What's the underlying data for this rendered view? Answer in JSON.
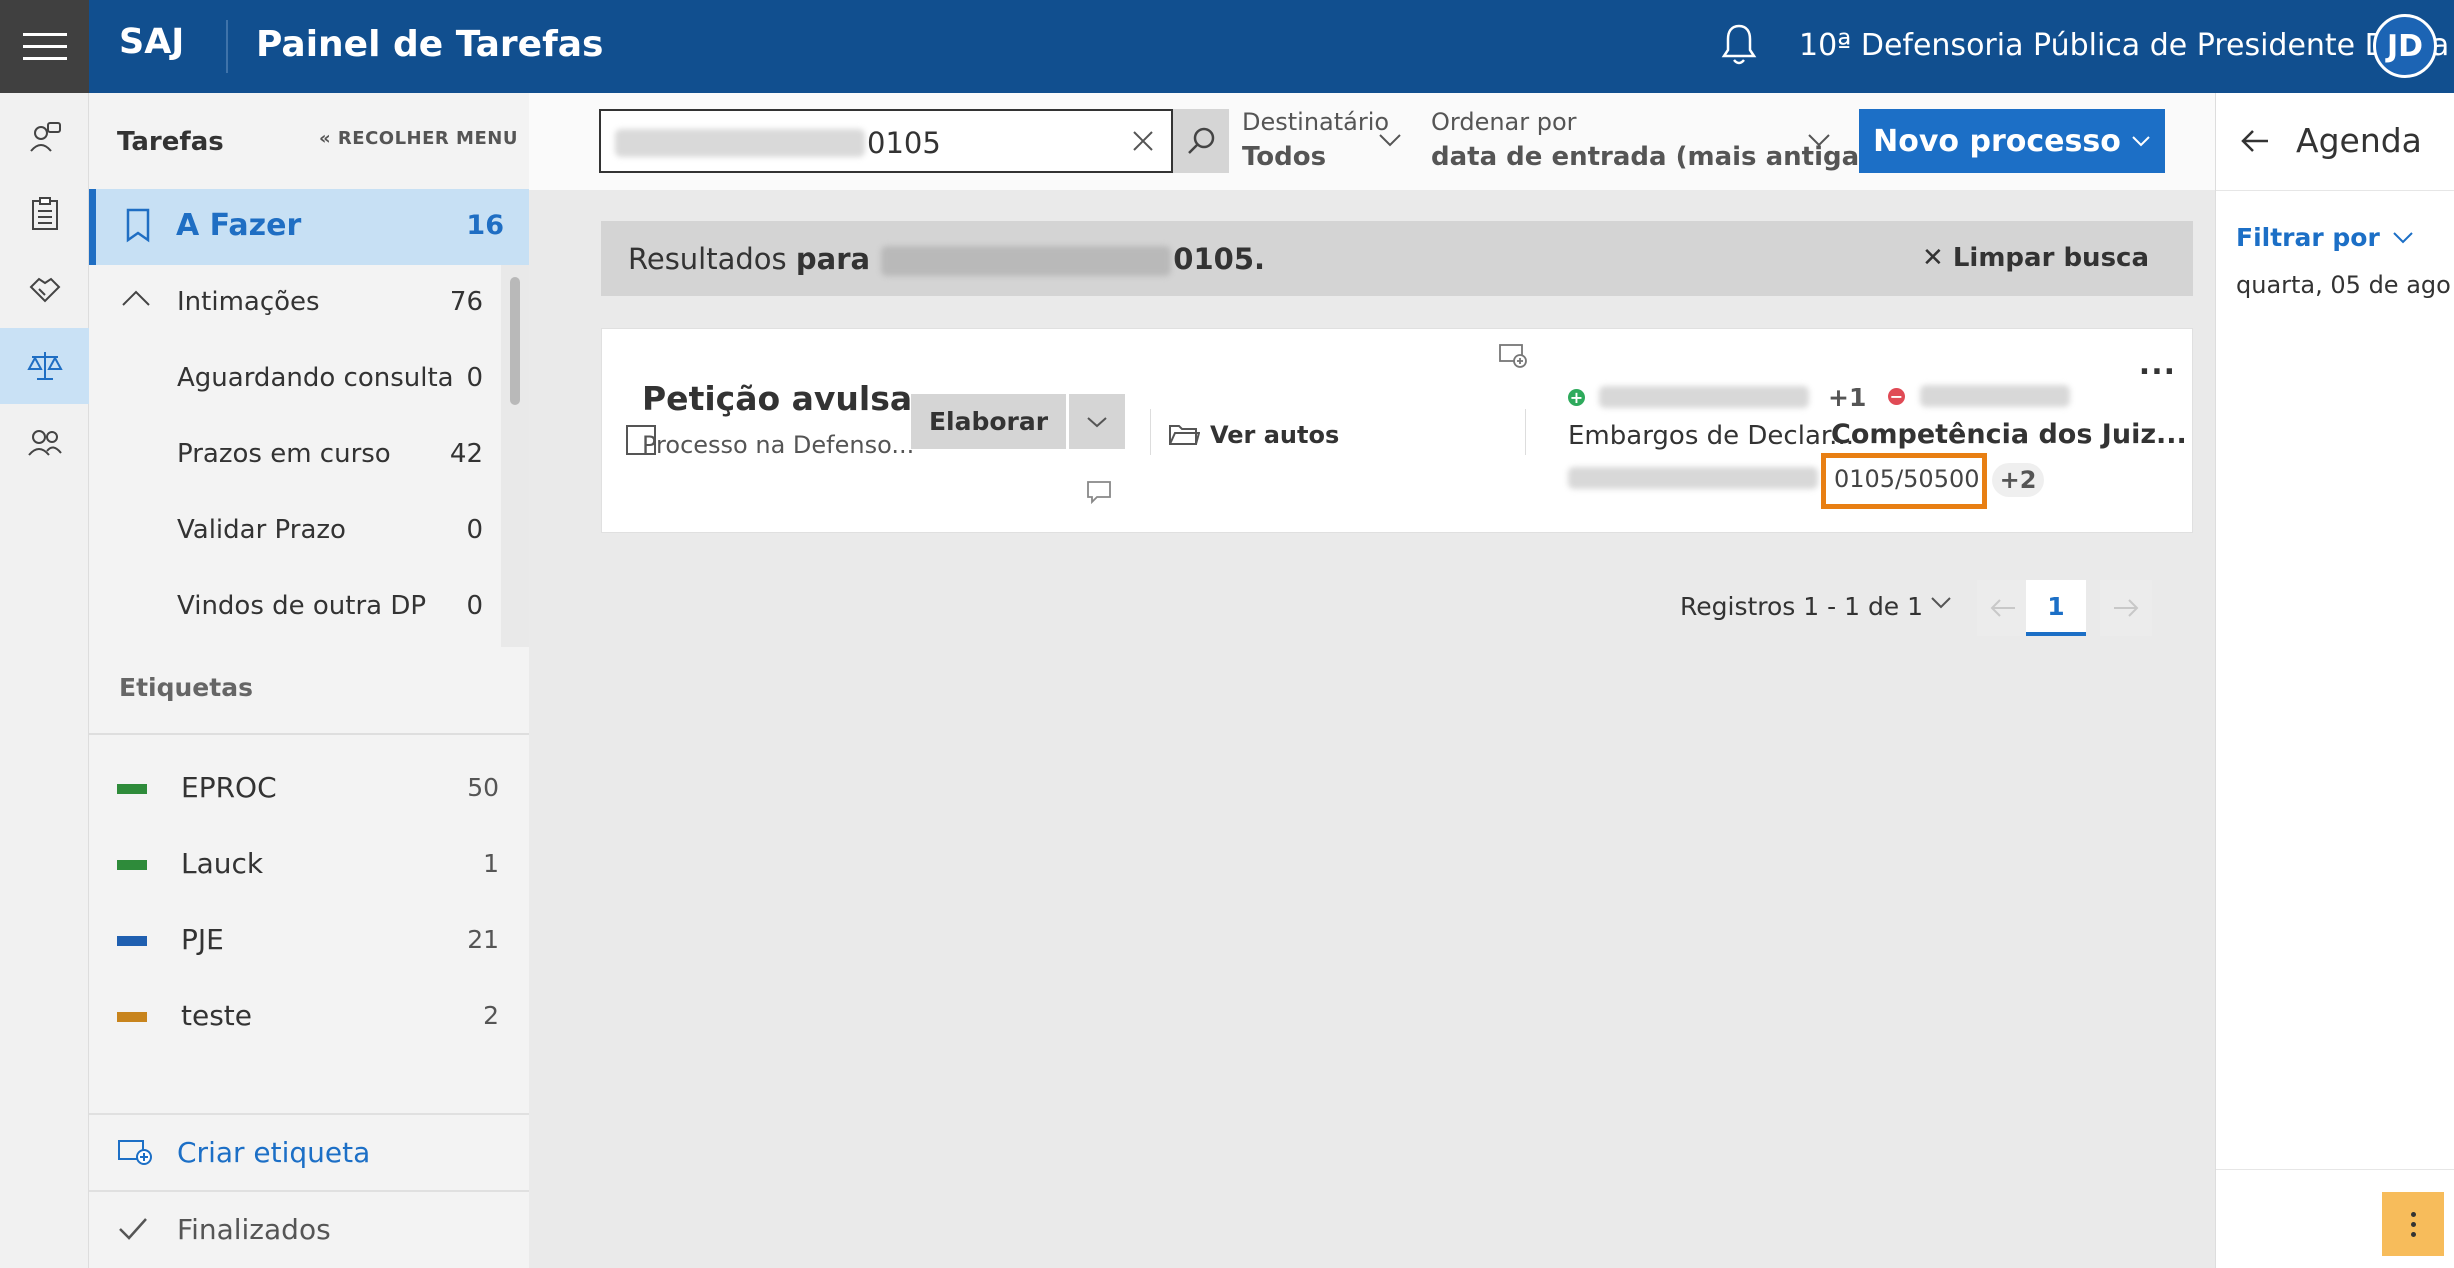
{
  "topbar": {
    "brand": "SAJ",
    "title": "Painel de Tarefas",
    "org": "10ª Defensoria Pública de Presidente Dutra",
    "avatar_initials": "JD"
  },
  "colors": {
    "topbar": "#114f8f",
    "accent": "#1c6fc6",
    "highlight_box": "#e87f13"
  },
  "rail": {
    "icons": [
      "people-chat-icon",
      "clipboard-icon",
      "handshake-icon",
      "scales-icon",
      "group-icon"
    ]
  },
  "sidebar": {
    "heading": "Tarefas",
    "collapse_label": "RECOLHER MENU",
    "main_item": {
      "label": "A Fazer",
      "count": "16"
    },
    "items": [
      {
        "label": "Intimações",
        "count": "76"
      },
      {
        "label": "Aguardando consulta",
        "count": "0"
      },
      {
        "label": "Prazos em curso",
        "count": "42"
      },
      {
        "label": "Validar Prazo",
        "count": "0"
      },
      {
        "label": "Vindos de outra DP",
        "count": "0"
      }
    ],
    "tags_title": "Etiquetas",
    "tags": [
      {
        "label": "EPROC",
        "count": "50",
        "color": "#2e8b3a"
      },
      {
        "label": "Lauck",
        "count": "1",
        "color": "#2e8b3a"
      },
      {
        "label": "PJE",
        "count": "21",
        "color": "#1f5fb0"
      },
      {
        "label": "teste",
        "count": "2",
        "color": "#c8841d"
      }
    ],
    "create_tag": "Criar etiqueta",
    "finished": "Finalizados"
  },
  "toolbar": {
    "search_value": "0105",
    "dest_label": "Destinatário",
    "dest_value": "Todos",
    "order_label": "Ordenar por",
    "order_value": "data de entrada (mais antiga)",
    "new_button": "Novo processo"
  },
  "results": {
    "prefix": "Resultados",
    "para": "para",
    "query_suffix": "0105.",
    "clear": "Limpar busca"
  },
  "card": {
    "title": "Petição avulsa",
    "subtitle": "Processo na Defenso...",
    "elaborate": "Elaborar",
    "view_records": "Ver autos",
    "party_more": "+1",
    "class_label": "Embargos de Declar...",
    "subject_label": "Competência dos Juiz...",
    "process_number": "0105/50500",
    "subject_more": "+2",
    "more": "..."
  },
  "pager": {
    "records": "Registros 1 - 1 de 1",
    "current_page": "1"
  },
  "agenda": {
    "title": "Agenda",
    "filter": "Filtrar por",
    "date": "quarta, 05 de ago"
  }
}
